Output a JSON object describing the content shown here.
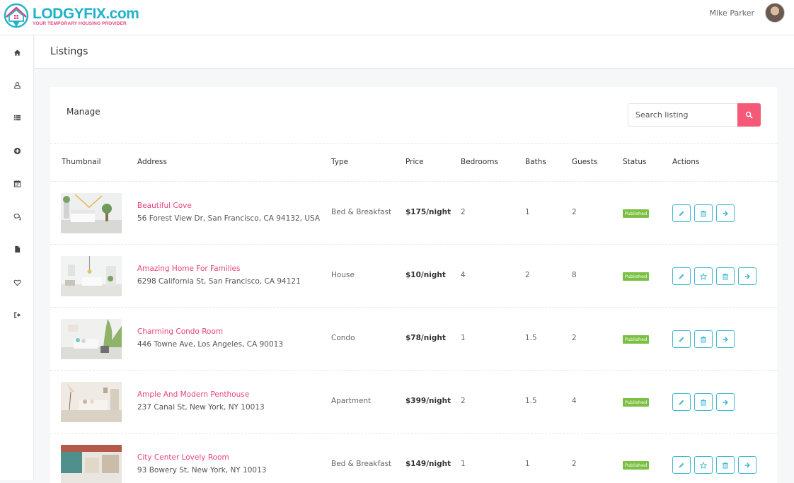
{
  "brand": {
    "name": "LODGYFIX.com",
    "tagline": "YOUR TEMPORARY HOUSING PROVIDER"
  },
  "user": {
    "name": "Mike Parker"
  },
  "sidebar": {
    "icons": [
      "home-icon",
      "user-icon",
      "list-icon",
      "plus-circle-icon",
      "calendar-icon",
      "chat-icon",
      "file-icon",
      "heart-icon",
      "logout-icon"
    ]
  },
  "page": {
    "title": "Listings"
  },
  "card": {
    "title": "Manage"
  },
  "search": {
    "placeholder": "Search listing"
  },
  "table": {
    "headers": {
      "thumbnail": "Thumbnail",
      "address": "Address",
      "type": "Type",
      "price": "Price",
      "bedrooms": "Bedrooms",
      "baths": "Baths",
      "guests": "Guests",
      "status": "Status",
      "actions": "Actions"
    },
    "rows": [
      {
        "title": "Beautiful Cove",
        "address": "56 Forest View Dr, San Francisco, CA 94132, USA",
        "type": "Bed & Breakfast",
        "price": "$175/night",
        "bedrooms": "2",
        "baths": "1",
        "guests": "2",
        "status": "Published"
      },
      {
        "title": "Amazing Home For Families",
        "address": "6298 California St, San Francisco, CA 94121",
        "type": "House",
        "price": "$10/night",
        "bedrooms": "4",
        "baths": "2",
        "guests": "8",
        "status": "Published"
      },
      {
        "title": "Charming Condo Room",
        "address": "446 Towne Ave, Los Angeles, CA 90013",
        "type": "Condo",
        "price": "$78/night",
        "bedrooms": "1",
        "baths": "1.5",
        "guests": "2",
        "status": "Published"
      },
      {
        "title": "Ample And Modern Penthouse",
        "address": "237 Canal St, New York, NY 10013",
        "type": "Apartment",
        "price": "$399/night",
        "bedrooms": "2",
        "baths": "1.5",
        "guests": "4",
        "status": "Published"
      },
      {
        "title": "City Center Lovely Room",
        "address": "93 Bowery St, New York, NY 10013",
        "type": "Bed & Breakfast",
        "price": "$149/night",
        "bedrooms": "1",
        "baths": "1",
        "guests": "2",
        "status": "Published"
      }
    ]
  },
  "colors": {
    "accent": "#e8437d",
    "brand": "#1fb2c9",
    "action": "#3fb8d4",
    "search_button": "#f45a77",
    "badge": "#7cc043"
  }
}
